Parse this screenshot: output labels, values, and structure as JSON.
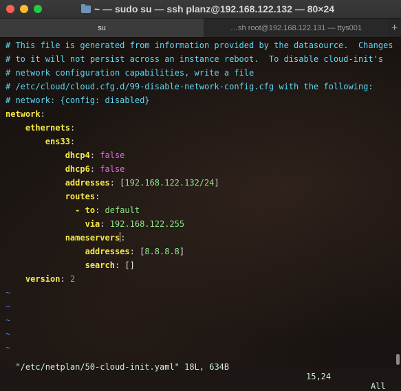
{
  "window": {
    "title": "~ — sudo su — ssh planz@192.168.122.132 — 80×24"
  },
  "tabs": [
    {
      "label": "su",
      "active": true
    },
    {
      "label": "…sh root@192.168.122.131 — ttys001",
      "active": false
    }
  ],
  "file": {
    "comments": [
      "# This file is generated from information provided by the datasource.  Changes",
      "# to it will not persist across an instance reboot.  To disable cloud-init's",
      "# network configuration capabilities, write a file",
      "# /etc/cloud/cloud.cfg.d/99-disable-network-config.cfg with the following:",
      "# network: {config: disabled}"
    ],
    "network_key": "network",
    "ethernets_key": "ethernets",
    "interface_key": "ens33",
    "dhcp4_key": "dhcp4",
    "dhcp4_value": "false",
    "dhcp6_key": "dhcp6",
    "dhcp6_value": "false",
    "addresses_key": "addresses",
    "addresses_value": "192.168.122.132/24",
    "routes_key": "routes",
    "route_to_key": "to",
    "route_to_value": "default",
    "route_via_key": "via",
    "route_via_value": "192.168.122.255",
    "nameservers_key": "nameservers",
    "ns_addresses_key": "addresses",
    "ns_addresses_value": "8.8.8.8",
    "search_key": "search",
    "search_value": "[]",
    "version_key": "version",
    "version_value": "2"
  },
  "tilde_lines": [
    "~",
    "~",
    "~",
    "~",
    "~"
  ],
  "status": {
    "filename": "\"/etc/netplan/50-cloud-init.yaml\" 18L, 634B",
    "position": "15,24",
    "scroll": "All"
  },
  "colors": {
    "comment": "#5fd7f5",
    "key": "#f6e94b",
    "boolean": "#e26be0",
    "value": "#8ae98a",
    "tilde": "#5b7fd8"
  }
}
